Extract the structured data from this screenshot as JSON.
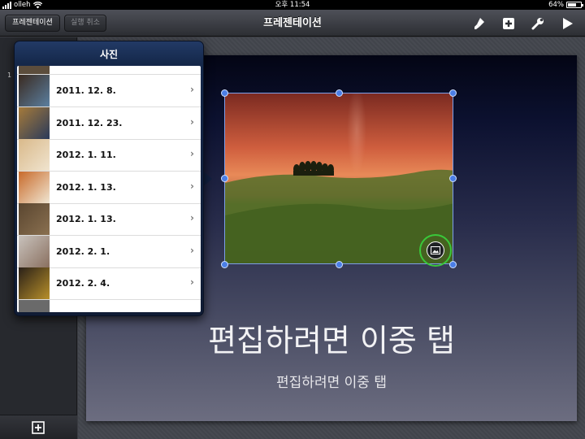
{
  "status_bar": {
    "carrier": "olleh",
    "time": "오후 11:54",
    "battery": "64%",
    "battery_level": 0.64
  },
  "toolbar": {
    "presentations_label": "프레젠테이션",
    "undo_label": "실행 취소",
    "title": "프레젠테이션",
    "icons": [
      "brush-icon",
      "insert-plus-icon",
      "wrench-icon",
      "play-icon"
    ]
  },
  "sidebar": {
    "slide_number": "1"
  },
  "slide": {
    "title_placeholder": "편집하려면 이중 탭",
    "subtitle_placeholder": "편집하려면 이중 탭"
  },
  "popover": {
    "title": "사진",
    "items": [
      {
        "label": "2011. 12. 8.",
        "thumb_colors": [
          "#3a2a20",
          "#5b7fa0"
        ]
      },
      {
        "label": "2011. 12. 23.",
        "thumb_colors": [
          "#a57a3a",
          "#2a3a5a"
        ]
      },
      {
        "label": "2012. 1. 11.",
        "thumb_colors": [
          "#d9b98a",
          "#f0e4cf"
        ]
      },
      {
        "label": "2012. 1. 13.",
        "thumb_colors": [
          "#c86a2a",
          "#f0e6d2"
        ]
      },
      {
        "label": "2012. 1. 13.",
        "thumb_colors": [
          "#5a4630",
          "#8a7050"
        ]
      },
      {
        "label": "2012. 2. 1.",
        "thumb_colors": [
          "#c8c2bc",
          "#8a7060"
        ]
      },
      {
        "label": "2012. 2. 4.",
        "thumb_colors": [
          "#2a2018",
          "#b8902a"
        ]
      }
    ]
  },
  "colors": {
    "selection": "#4b7ee6",
    "highlight_ring": "#3ac83a"
  }
}
